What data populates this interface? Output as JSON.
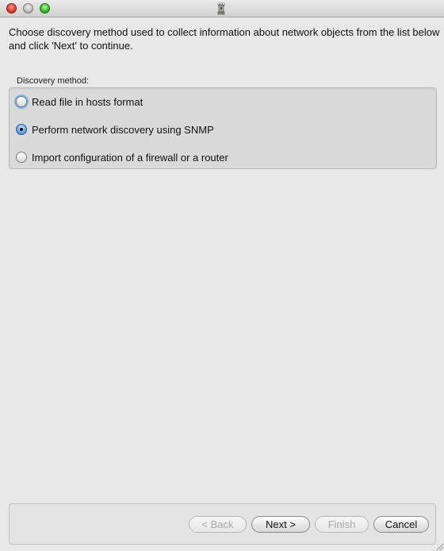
{
  "window": {
    "title": "",
    "controls": [
      "close",
      "minimize",
      "zoom"
    ]
  },
  "instructions": "Choose discovery method used to collect information about network objects from the list below and click 'Next' to continue.",
  "discovery_group": {
    "label": "Discovery method:",
    "options": [
      {
        "label": "Read file in hosts format",
        "selected": false
      },
      {
        "label": "Perform network discovery using SNMP",
        "selected": true
      },
      {
        "label": "Import configuration of a firewall or a router",
        "selected": false
      }
    ]
  },
  "buttons": {
    "back": {
      "label": "< Back",
      "enabled": false
    },
    "next": {
      "label": "Next >",
      "enabled": true
    },
    "finish": {
      "label": "Finish",
      "enabled": false
    },
    "cancel": {
      "label": "Cancel",
      "enabled": true
    }
  },
  "colors": {
    "close": "#e0443a",
    "minimize": "#bdbdbd",
    "zoom": "#3fbf2c",
    "radio_selected": "#2d6cc4",
    "focus_ring": "#7db3ec"
  }
}
